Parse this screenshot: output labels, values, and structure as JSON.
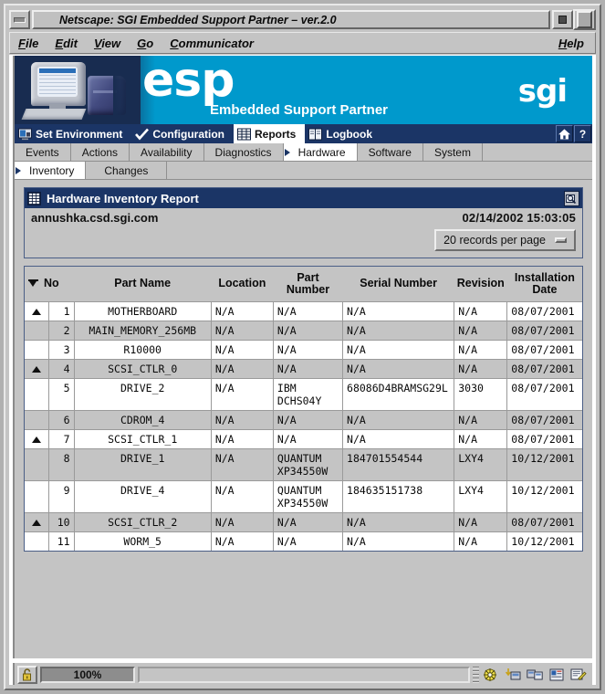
{
  "window": {
    "title": "Netscape: SGI Embedded Support Partner – ver.2.0",
    "minimize_label": "Minimize",
    "maximize_label": "Maximize",
    "restore_label": "Restore"
  },
  "menubar": {
    "items": [
      {
        "label": "File",
        "mnemonic": "F"
      },
      {
        "label": "Edit",
        "mnemonic": "E"
      },
      {
        "label": "View",
        "mnemonic": "V"
      },
      {
        "label": "Go",
        "mnemonic": "G"
      },
      {
        "label": "Communicator",
        "mnemonic": "C"
      }
    ],
    "help_label": "Help"
  },
  "banner": {
    "logo_text": "esp",
    "subtitle": "Embedded Support Partner",
    "brand": "sgi",
    "background_color": "#0099cc",
    "art_background_color": "#182c50"
  },
  "nav_primary": {
    "items": [
      {
        "label": "Set Environment",
        "icon": "monitor-icon",
        "active": false
      },
      {
        "label": "Configuration",
        "icon": "checkmark-icon",
        "active": false
      },
      {
        "label": "Reports",
        "icon": "grid-icon",
        "active": true
      },
      {
        "label": "Logbook",
        "icon": "book-icon",
        "active": false
      }
    ],
    "home_label": "Home",
    "help_label": "?",
    "background_color": "#1b3566"
  },
  "nav_secondary": {
    "tabs": [
      {
        "label": "Events",
        "active": false
      },
      {
        "label": "Actions",
        "active": false
      },
      {
        "label": "Availability",
        "active": false
      },
      {
        "label": "Diagnostics",
        "active": false
      },
      {
        "label": "Hardware",
        "active": true
      },
      {
        "label": "Software",
        "active": false
      },
      {
        "label": "System",
        "active": false
      }
    ]
  },
  "nav_tertiary": {
    "tabs": [
      {
        "label": "Inventory",
        "active": true
      },
      {
        "label": "Changes",
        "active": false
      }
    ]
  },
  "report": {
    "title": "Hardware Inventory Report",
    "title_icon": "report-grid-icon",
    "print_icon": "print-preview-icon",
    "hostname": "annushka.csd.sgi.com",
    "timestamp": "02/14/2002  15:03:05",
    "records_per_page": "20 records per page"
  },
  "table": {
    "columns": [
      {
        "key": "tri",
        "label": ""
      },
      {
        "key": "no",
        "label": "No"
      },
      {
        "key": "name",
        "label": "Part Name"
      },
      {
        "key": "loc",
        "label": "Location"
      },
      {
        "key": "pn",
        "label": "Part Number"
      },
      {
        "key": "sn",
        "label": "Serial Number"
      },
      {
        "key": "rev",
        "label": "Revision"
      },
      {
        "key": "date",
        "label": "Installation Date"
      }
    ],
    "sort_icon": "sort-descending-icon",
    "rows": [
      {
        "expander": true,
        "no": "1",
        "name": "MOTHERBOARD",
        "indent": 0,
        "loc": "N/A",
        "pn": "N/A",
        "sn": "N/A",
        "rev": "N/A",
        "date": "08/07/2001",
        "alt": false
      },
      {
        "expander": false,
        "no": "2",
        "name": "MAIN_MEMORY_256MB",
        "indent": 0,
        "loc": "N/A",
        "pn": "N/A",
        "sn": "N/A",
        "rev": "N/A",
        "date": "08/07/2001",
        "alt": true
      },
      {
        "expander": false,
        "no": "3",
        "name": "R10000",
        "indent": 0,
        "loc": "N/A",
        "pn": "N/A",
        "sn": "N/A",
        "rev": "N/A",
        "date": "08/07/2001",
        "alt": false
      },
      {
        "expander": true,
        "no": "4",
        "name": "SCSI_CTLR_0",
        "indent": 0,
        "loc": "N/A",
        "pn": "N/A",
        "sn": "N/A",
        "rev": "N/A",
        "date": "08/07/2001",
        "alt": true
      },
      {
        "expander": false,
        "no": "5",
        "name": "DRIVE_2",
        "indent": 1,
        "loc": "N/A",
        "pn": "IBM DCHS04Y",
        "sn": "68086D4BRAMSG29L",
        "rev": "3030",
        "date": "08/07/2001",
        "alt": false
      },
      {
        "expander": false,
        "no": "6",
        "name": "CDROM_4",
        "indent": 1,
        "loc": "N/A",
        "pn": "N/A",
        "sn": "N/A",
        "rev": "N/A",
        "date": "08/07/2001",
        "alt": true
      },
      {
        "expander": true,
        "no": "7",
        "name": "SCSI_CTLR_1",
        "indent": 0,
        "loc": "N/A",
        "pn": "N/A",
        "sn": "N/A",
        "rev": "N/A",
        "date": "08/07/2001",
        "alt": false
      },
      {
        "expander": false,
        "no": "8",
        "name": "DRIVE_1",
        "indent": 1,
        "loc": "N/A",
        "pn": "QUANTUM XP34550W",
        "sn": "184701554544",
        "rev": "LXY4",
        "date": "10/12/2001",
        "alt": true
      },
      {
        "expander": false,
        "no": "9",
        "name": "DRIVE_4",
        "indent": 1,
        "loc": "N/A",
        "pn": "QUANTUM XP34550W",
        "sn": "184635151738",
        "rev": "LXY4",
        "date": "10/12/2001",
        "alt": false
      },
      {
        "expander": true,
        "no": "10",
        "name": "SCSI_CTLR_2",
        "indent": 0,
        "loc": "N/A",
        "pn": "N/A",
        "sn": "N/A",
        "rev": "N/A",
        "date": "08/07/2001",
        "alt": true
      },
      {
        "expander": false,
        "no": "11",
        "name": "WORM_5",
        "indent": 1,
        "loc": "N/A",
        "pn": "N/A",
        "sn": "N/A",
        "rev": "N/A",
        "date": "10/12/2001",
        "alt": false
      }
    ]
  },
  "statusbar": {
    "security_icon": "unlocked-padlock-icon",
    "progress_label": "100%",
    "message": "",
    "component_icons": [
      "navigator-icon",
      "inbox-icon",
      "newsgroups-icon",
      "address-book-icon",
      "composer-icon"
    ]
  }
}
